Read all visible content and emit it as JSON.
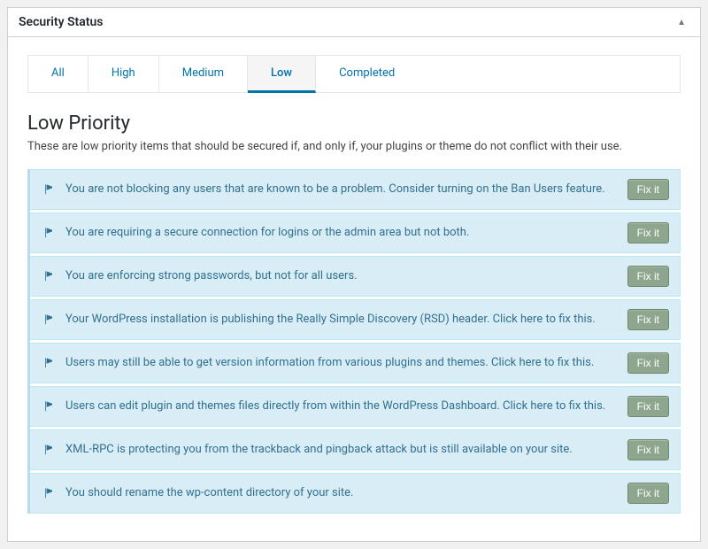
{
  "header": {
    "title": "Security Status"
  },
  "tabs": [
    {
      "label": "All",
      "active": false
    },
    {
      "label": "High",
      "active": false
    },
    {
      "label": "Medium",
      "active": false
    },
    {
      "label": "Low",
      "active": true
    },
    {
      "label": "Completed",
      "active": false
    }
  ],
  "section": {
    "title": "Low Priority",
    "description": "These are low priority items that should be secured if, and only if, your plugins or theme do not conflict with their use."
  },
  "fix_label": "Fix it",
  "issues": [
    {
      "text": "You are not blocking any users that are known to be a problem. Consider turning on the Ban Users feature."
    },
    {
      "text": "You are requiring a secure connection for logins or the admin area but not both."
    },
    {
      "text": "You are enforcing strong passwords, but not for all users."
    },
    {
      "text": "Your WordPress installation is publishing the Really Simple Discovery (RSD) header. Click here to fix this."
    },
    {
      "text": "Users may still be able to get version information from various plugins and themes. Click here to fix this."
    },
    {
      "text": "Users can edit plugin and themes files directly from within the WordPress Dashboard. Click here to fix this."
    },
    {
      "text": "XML-RPC is protecting you from the trackback and pingback attack but is still available on your site."
    },
    {
      "text": "You should rename the wp-content directory of your site."
    }
  ]
}
